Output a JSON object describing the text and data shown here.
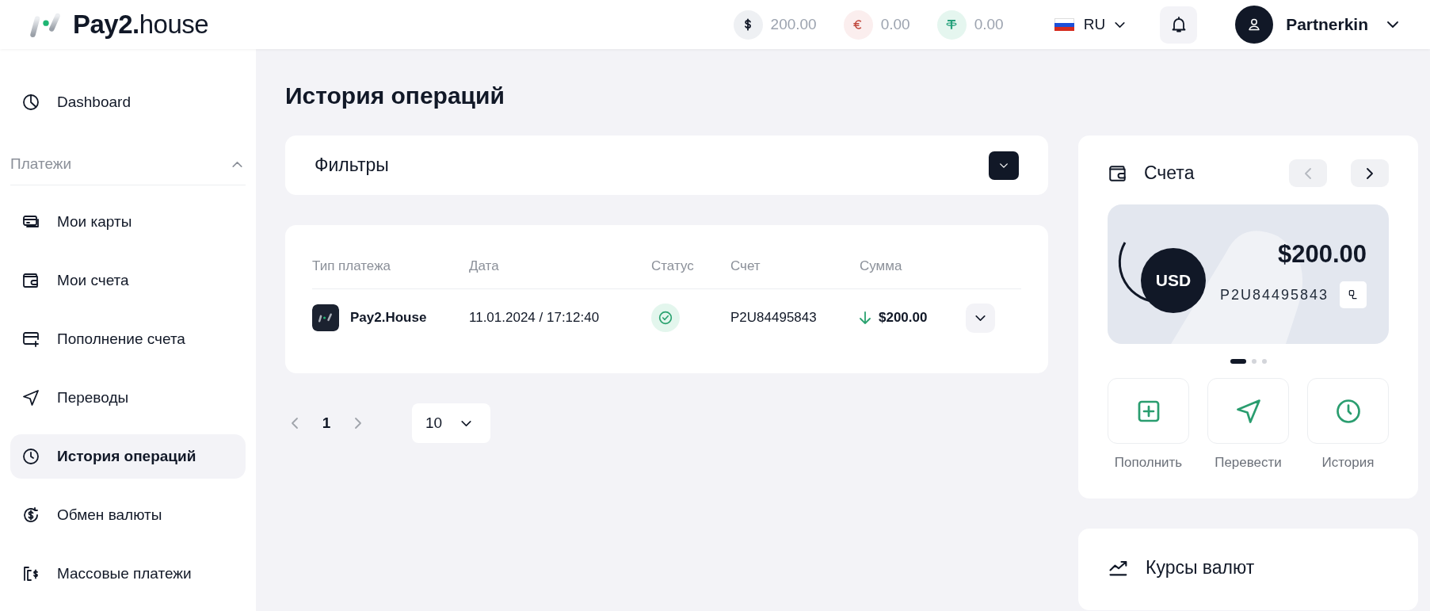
{
  "header": {
    "logo": {
      "bold": "Pay2.",
      "light": "house"
    },
    "balances": [
      {
        "amount": "200.00"
      },
      {
        "amount": "0.00"
      },
      {
        "amount": "0.00"
      }
    ],
    "language": "RU",
    "user": "Partnerkin"
  },
  "sidebar": {
    "items": [
      {
        "label": "Dashboard",
        "selected": false
      }
    ],
    "sections": [
      {
        "title": "Платежи",
        "expanded": true,
        "items": [
          {
            "label": "Мои карты",
            "selected": false
          },
          {
            "label": "Мои счета",
            "selected": false
          },
          {
            "label": "Пополнение счета",
            "selected": false
          },
          {
            "label": "Переводы",
            "selected": false
          },
          {
            "label": "История операций",
            "selected": true
          },
          {
            "label": "Обмен валюты",
            "selected": false
          },
          {
            "label": "Массовые платежи",
            "selected": false
          }
        ]
      }
    ]
  },
  "page_title": "История операций",
  "filters": {
    "title": "Фильтры",
    "expanded": false
  },
  "table": {
    "columns": [
      "Тип платежа",
      "Дата",
      "Статус",
      "Счет",
      "Сумма"
    ],
    "rows": [
      {
        "type": "Pay2.House",
        "date": "11.01.2024 / 17:12:40",
        "completed": true,
        "account": "P2U84495843",
        "amount": "$200.00",
        "incoming": true,
        "expanded": false
      }
    ]
  },
  "pagination": {
    "pages": [
      {
        "label": "1",
        "selected": true
      }
    ],
    "page_size": "10"
  },
  "accounts": {
    "title": "Счета",
    "prev_disabled": true,
    "next_disabled": false,
    "card": {
      "currency": "USD",
      "balance": "$200.00",
      "number": "P2U84495843"
    },
    "slides": [
      {
        "selected": true
      },
      {
        "selected": false
      },
      {
        "selected": false
      }
    ],
    "actions": [
      {
        "label": "Пополнить"
      },
      {
        "label": "Перевести"
      },
      {
        "label": "История"
      }
    ]
  },
  "rates": {
    "title": "Курсы валют"
  }
}
